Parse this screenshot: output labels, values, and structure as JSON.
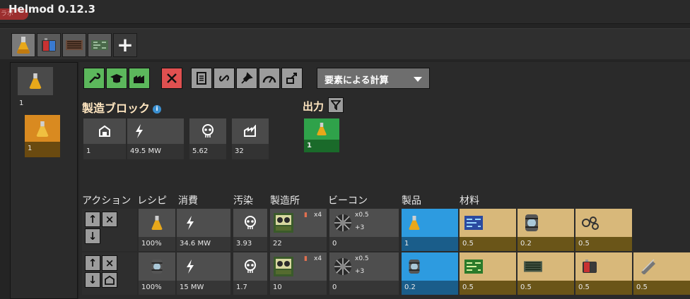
{
  "window": {
    "title": "Helmod 0.12.3",
    "ribbon": "ラボ"
  },
  "tabs": [
    "science-flask-icon",
    "battery-icon",
    "engine-icon",
    "circuit-icon",
    "add"
  ],
  "sidebar": {
    "blocks": [
      {
        "count": "1"
      },
      {
        "count": "1"
      }
    ]
  },
  "toolbar": {
    "buttons": [
      "wrench-icon",
      "graduation-icon",
      "factory-icon",
      "close-icon",
      "document-icon",
      "link-icon",
      "pin-icon",
      "speedometer-icon",
      "export-icon"
    ],
    "dropdown_label": "要素による計算"
  },
  "block": {
    "title": "製造ブロック",
    "output_label": "出力",
    "stats": [
      {
        "icon": "building-icon",
        "value": "1"
      },
      {
        "icon": "lightning-icon",
        "value": "49.5 MW"
      },
      {
        "icon": "pollution-skull-icon",
        "value": "5.62"
      },
      {
        "icon": "factory-icon",
        "value": "32"
      }
    ],
    "product": {
      "icon": "science-flask-icon",
      "value": "1"
    }
  },
  "table": {
    "headers": [
      "アクション",
      "レシピ",
      "消費",
      "汚染",
      "製造所",
      "ビーコン",
      "製品",
      "材料"
    ],
    "rows": [
      {
        "recipe": {
          "icon": "science-flask-icon",
          "value": "100%"
        },
        "energy": {
          "icon": "lightning-icon",
          "value": "34.6 MW"
        },
        "pollution": {
          "icon": "pollution-skull-icon",
          "value": "3.93"
        },
        "factory": {
          "icon": "assembler-icon",
          "value": "22",
          "modules": "x4"
        },
        "beacon": {
          "icon": "beacon-icon",
          "value": "0",
          "mult": "x0.5",
          "plus": "+3"
        },
        "products": [
          {
            "icon": "science-flask-icon",
            "value": "1"
          }
        ],
        "ingredients": [
          {
            "icon": "processing-unit-icon",
            "value": "0.5"
          },
          {
            "icon": "low-density-structure-icon",
            "value": "0.2"
          },
          {
            "icon": "rail-icon",
            "value": "0.5"
          }
        ]
      },
      {
        "recipe": {
          "icon": "low-density-structure-icon",
          "value": "100%"
        },
        "energy": {
          "icon": "lightning-icon",
          "value": "15 MW"
        },
        "pollution": {
          "icon": "pollution-skull-icon",
          "value": "1.7"
        },
        "factory": {
          "icon": "assembler-icon",
          "value": "10",
          "modules": "x4"
        },
        "beacon": {
          "icon": "beacon-icon",
          "value": "0",
          "mult": "x0.5",
          "plus": "+3"
        },
        "products": [
          {
            "icon": "low-density-structure-icon",
            "value": "0.2"
          }
        ],
        "ingredients": [
          {
            "icon": "circuit-icon",
            "value": "0.5"
          },
          {
            "icon": "engine-icon",
            "value": "0.5"
          },
          {
            "icon": "battery-icon",
            "value": "0.5"
          },
          {
            "icon": "steel-beam-icon",
            "value": "0.5"
          }
        ]
      }
    ]
  }
}
